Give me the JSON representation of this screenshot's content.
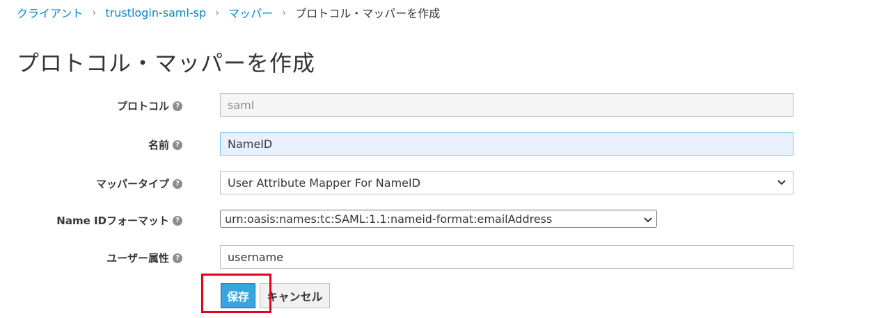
{
  "breadcrumb": {
    "items": [
      "クライアント",
      "trustlogin-saml-sp",
      "マッパー"
    ],
    "separator": "›",
    "current": "プロトコル・マッパーを作成"
  },
  "page": {
    "title": "プロトコル・マッパーを作成"
  },
  "form": {
    "protocol": {
      "label": "プロトコル",
      "value": "saml"
    },
    "name": {
      "label": "名前",
      "value": "NameID"
    },
    "mapper_type": {
      "label": "マッパータイプ",
      "value": "User Attribute Mapper For NameID"
    },
    "name_id_format": {
      "label": "Name IDフォーマット",
      "value": "urn:oasis:names:tc:SAML:1.1:nameid-format:emailAddress"
    },
    "user_attribute": {
      "label": "ユーザー属性",
      "value": "username"
    }
  },
  "icons": {
    "help": "question-circle-icon",
    "dropdown": "chevron-down-icon"
  },
  "help_glyph": "?",
  "chevron_glyph": "⌄",
  "buttons": {
    "save": "保存",
    "cancel": "キャンセル"
  },
  "colors": {
    "link": "#0088ce",
    "primary": "#39a5dc",
    "highlight": "#e3001b"
  }
}
